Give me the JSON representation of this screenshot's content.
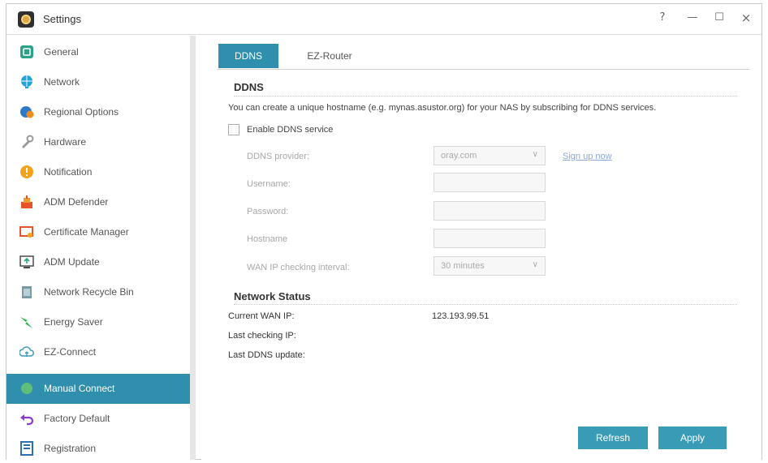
{
  "window": {
    "title": "Settings",
    "controls": {
      "help": "?",
      "minimize": "—",
      "maximize": "☐",
      "close": "×"
    }
  },
  "sidebar": {
    "items": [
      {
        "label": "General",
        "icon": "general-icon"
      },
      {
        "label": "Network",
        "icon": "network-icon"
      },
      {
        "label": "Regional Options",
        "icon": "regional-icon"
      },
      {
        "label": "Hardware",
        "icon": "hardware-icon"
      },
      {
        "label": "Notification",
        "icon": "notification-icon"
      },
      {
        "label": "ADM Defender",
        "icon": "defender-icon"
      },
      {
        "label": "Certificate Manager",
        "icon": "certificate-icon"
      },
      {
        "label": "ADM Update",
        "icon": "update-icon"
      },
      {
        "label": "Network Recycle Bin",
        "icon": "recycle-bin-icon"
      },
      {
        "label": "Energy Saver",
        "icon": "energy-icon"
      },
      {
        "label": "EZ-Connect",
        "icon": "cloud-icon"
      },
      {
        "label": "Manual Connect",
        "icon": "manual-connect-icon",
        "active": true
      },
      {
        "label": "Factory Default",
        "icon": "undo-icon"
      },
      {
        "label": "Registration",
        "icon": "registration-icon"
      }
    ]
  },
  "tabs": [
    {
      "label": "DDNS",
      "active": true
    },
    {
      "label": "EZ-Router",
      "active": false
    }
  ],
  "ddns": {
    "title": "DDNS",
    "description": "You can create a unique hostname (e.g. mynas.asustor.org) for your NAS by subscribing for DDNS services.",
    "enable_label": "Enable DDNS service",
    "enabled": false,
    "provider_label": "DDNS provider:",
    "provider_value": "oray.com",
    "signup_link": "Sign up now",
    "username_label": "Username:",
    "username_value": "",
    "password_label": "Password:",
    "password_value": "",
    "hostname_label": "Hostname",
    "hostname_value": "",
    "interval_label": "WAN IP checking interval:",
    "interval_value": "30 minutes"
  },
  "network_status": {
    "title": "Network Status",
    "wan_ip_label": "Current WAN IP:",
    "wan_ip_value": "123.193.99.51",
    "last_checking_label": "Last checking IP:",
    "last_checking_value": "",
    "last_update_label": "Last DDNS update:",
    "last_update_value": ""
  },
  "buttons": {
    "refresh": "Refresh",
    "apply": "Apply"
  },
  "colors": {
    "accent": "#2f8fad",
    "button": "#3a9bb7"
  }
}
